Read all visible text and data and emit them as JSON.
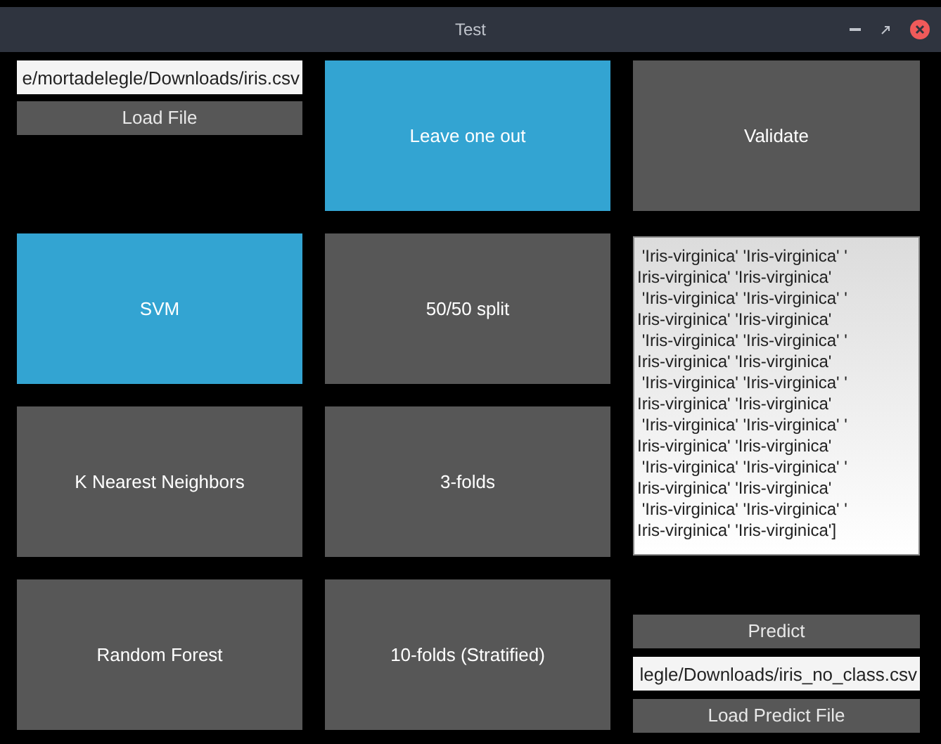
{
  "window": {
    "title": "Test"
  },
  "file_field": {
    "value": "e/mortadelegle/Downloads/iris.csv"
  },
  "load_file_button": "Load File",
  "classifiers": [
    {
      "label": "SVM",
      "selected": true
    },
    {
      "label": "K Nearest Neighbors",
      "selected": false
    },
    {
      "label": "Random Forest",
      "selected": false
    }
  ],
  "validation_methods": [
    {
      "label": "Leave one out",
      "selected": true
    },
    {
      "label": "50/50 split",
      "selected": false
    },
    {
      "label": "3-folds",
      "selected": false
    },
    {
      "label": "10-folds (Stratified)",
      "selected": false
    }
  ],
  "validate_button": "Validate",
  "output_lines": [
    " 'Iris-virginica' 'Iris-virginica' '",
    "Iris-virginica' 'Iris-virginica'",
    " 'Iris-virginica' 'Iris-virginica' '",
    "Iris-virginica' 'Iris-virginica'",
    " 'Iris-virginica' 'Iris-virginica' '",
    "Iris-virginica' 'Iris-virginica'",
    " 'Iris-virginica' 'Iris-virginica' '",
    "Iris-virginica' 'Iris-virginica'",
    " 'Iris-virginica' 'Iris-virginica' '",
    "Iris-virginica' 'Iris-virginica'",
    " 'Iris-virginica' 'Iris-virginica' '",
    "Iris-virginica' 'Iris-virginica'",
    " 'Iris-virginica' 'Iris-virginica' '",
    "Iris-virginica' 'Iris-virginica']"
  ],
  "predict_button": "Predict",
  "predict_file_field": {
    "value": "legle/Downloads/iris_no_class.csv"
  },
  "load_predict_button": "Load Predict File"
}
